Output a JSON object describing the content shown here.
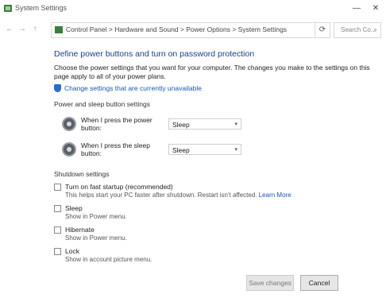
{
  "window": {
    "title": "System Settings",
    "minimize": "—",
    "close": "✕"
  },
  "addressbar": {
    "path": "Control Panel > Hardware and Sound > Power Options > System Settings",
    "back": "←",
    "forward": "→",
    "up": "↑",
    "refresh": "⟳",
    "search_placeholder": "Search Co..."
  },
  "content": {
    "heading": "Define power buttons and turn on password protection",
    "description": "Choose the power settings that you want for your computer. The changes you make to the settings on this page apply to all of your power plans.",
    "change_link": "Change settings that are currently unavailable",
    "section_label": "Power and sleep button settings",
    "settings": [
      {
        "label": "When I press the power button:",
        "value": "Sleep"
      },
      {
        "label": "When I press the sleep button:",
        "value": "Sleep"
      }
    ],
    "shutdown_title": "Shutdown settings",
    "checkboxes": [
      {
        "label": "Turn on fast startup (recommended)",
        "sub": "This helps start your PC faster after shutdown. Restart isn't affected.",
        "link": "Learn More"
      },
      {
        "label": "Sleep",
        "sub": "Show in Power menu."
      },
      {
        "label": "Hibernate",
        "sub": "Show in Power menu."
      },
      {
        "label": "Lock",
        "sub": "Show in account picture menu."
      }
    ]
  },
  "footer": {
    "save": "Save changes",
    "cancel": "Cancel"
  },
  "colors": {
    "heading": "#1a3e8c",
    "link": "#1a56b8",
    "icon_green": "#3c7d3c"
  }
}
